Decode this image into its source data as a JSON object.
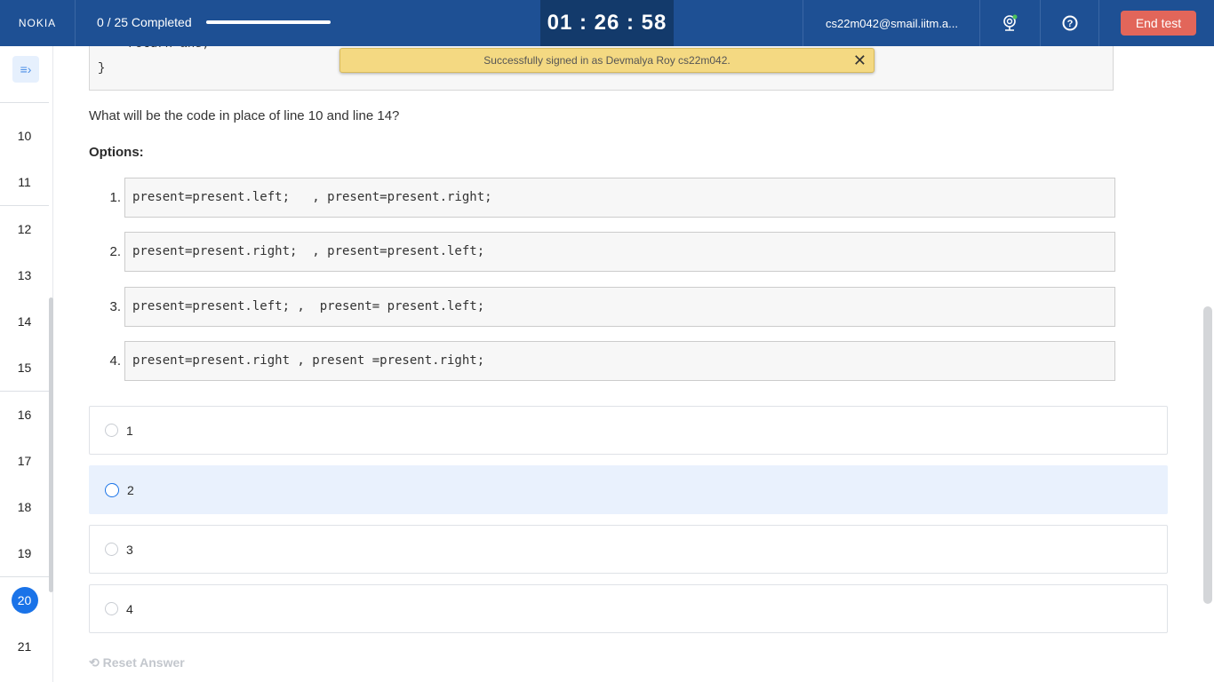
{
  "header": {
    "logo": "NOKIA",
    "progress_label": "0 / 25 Completed",
    "progress_fraction": 0,
    "timer": "01 : 26 : 58",
    "email": "cs22m042@smail.iitm.a...",
    "end_test": "End test",
    "icons": [
      "webcam-icon",
      "help-icon"
    ],
    "accent": "#1e5094",
    "end_color": "#e2665a"
  },
  "toast": {
    "message": "Successfully signed in as Devmalya Roy cs22m042."
  },
  "sidebar": {
    "questions": [
      "10",
      "11",
      "12",
      "13",
      "14",
      "15",
      "16",
      "17",
      "18",
      "19",
      "20",
      "21"
    ],
    "active": "20"
  },
  "question": {
    "code_tail": [
      "    return ans;",
      "}"
    ],
    "text": "What will be the code in place of line 10 and line 14?",
    "options_label": "Options:",
    "options": [
      {
        "num": "1.",
        "code": "present=present.left;   , present=present.right;"
      },
      {
        "num": "2.",
        "code": "present=present.right;  , present=present.left;"
      },
      {
        "num": "3.",
        "code": "present=present.left; ,  present= present.left;"
      },
      {
        "num": "4.",
        "code": "present=present.right , present =present.right;"
      }
    ],
    "answers": [
      "1",
      "2",
      "3",
      "4"
    ],
    "hovered": "2"
  },
  "reset_label": "Reset Answer"
}
